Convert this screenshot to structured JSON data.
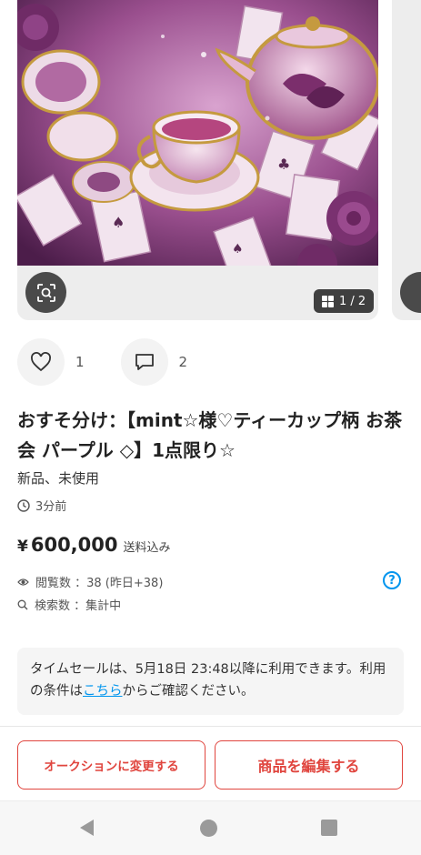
{
  "gallery": {
    "counter": "1 / 2",
    "image_icon": "lens-icon"
  },
  "actions": {
    "like_count": "1",
    "comment_count": "2"
  },
  "item": {
    "title": "おすそ分け：【mint☆様♡ティーカップ柄 お茶会 パープル ◇】1点限り☆",
    "condition": "新品、未使用",
    "posted": "3分前",
    "price_currency": "¥",
    "price": "600,000",
    "shipping": "送料込み"
  },
  "stats": {
    "views": "閲覧数 ：38 (昨日+38)",
    "searches": "検索数 ：集計中"
  },
  "notice": {
    "text_before": "タイムセールは、5月18日 23:48以降に利用できます。利用の条件は",
    "link": "こちら",
    "text_after": "からご確認ください。"
  },
  "buttons": {
    "auction": "オークションに変更する",
    "edit": "商品を編集する"
  },
  "colors": {
    "accent_red": "#e0453e",
    "link_blue": "#0095ee"
  }
}
